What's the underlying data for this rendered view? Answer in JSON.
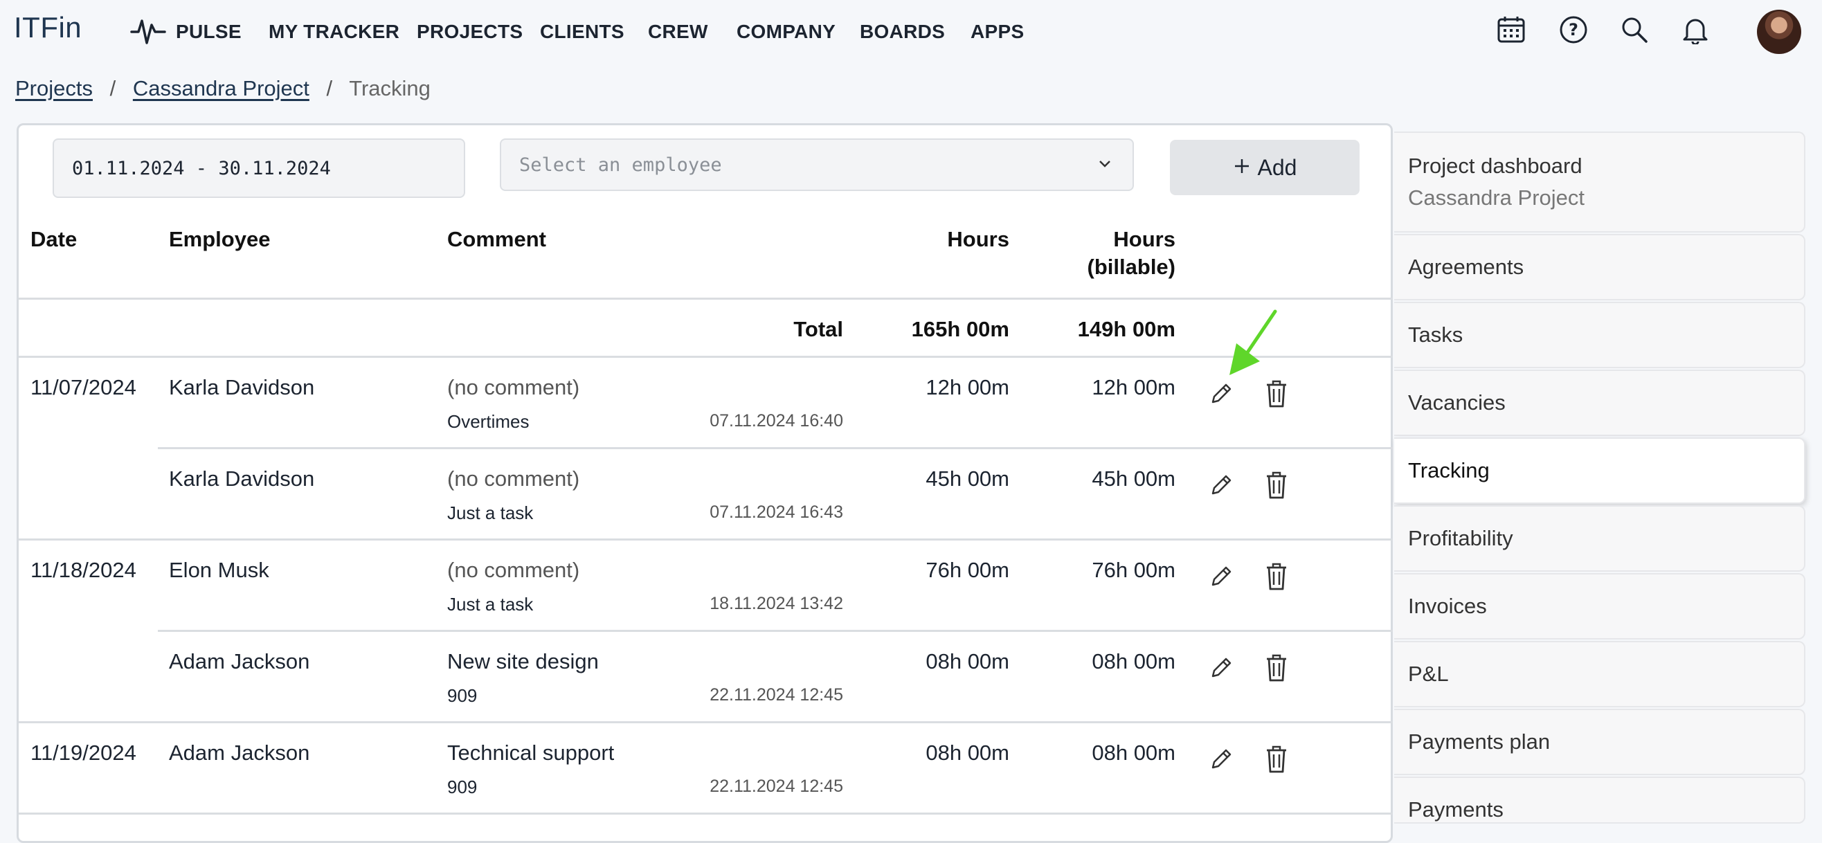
{
  "app": {
    "logo": "ITFin"
  },
  "nav": [
    {
      "label": "PULSE"
    },
    {
      "label": "MY TRACKER"
    },
    {
      "label": "PROJECTS"
    },
    {
      "label": "CLIENTS"
    },
    {
      "label": "CREW"
    },
    {
      "label": "COMPANY"
    },
    {
      "label": "BOARDS"
    },
    {
      "label": "APPS"
    }
  ],
  "header_icons": [
    "calendar-icon",
    "help-icon",
    "search-icon",
    "bell-icon"
  ],
  "breadcrumb": {
    "projects": "Projects",
    "sep": "/",
    "project": "Cassandra Project",
    "current": "Tracking"
  },
  "filters": {
    "date_range": "01.11.2024 - 30.11.2024",
    "employee_placeholder": "Select an employee",
    "add_label": "Add"
  },
  "table": {
    "headers": {
      "date": "Date",
      "employee": "Employee",
      "comment": "Comment",
      "hours": "Hours",
      "billable_line1": "Hours",
      "billable_line2": "(billable)"
    },
    "total": {
      "label": "Total",
      "hours": "165h 00m",
      "billable": "149h 00m"
    },
    "rows": [
      {
        "date": "11/07/2024",
        "employee": "Karla Davidson",
        "comment": "(no comment)",
        "task": "Overtimes",
        "timestamp": "07.11.2024 16:40",
        "hours": "12h 00m",
        "billable": "12h 00m"
      },
      {
        "date": "",
        "employee": "Karla Davidson",
        "comment": "(no comment)",
        "task": "Just a task",
        "timestamp": "07.11.2024 16:43",
        "hours": "45h 00m",
        "billable": "45h 00m"
      },
      {
        "date": "11/18/2024",
        "employee": "Elon Musk",
        "comment": "(no comment)",
        "task": "Just a task",
        "timestamp": "18.11.2024 13:42",
        "hours": "76h 00m",
        "billable": "76h 00m"
      },
      {
        "date": "",
        "employee": "Adam Jackson",
        "comment": "New site design",
        "task": "909",
        "timestamp": "22.11.2024 12:45",
        "hours": "08h 00m",
        "billable": "08h 00m"
      },
      {
        "date": "11/19/2024",
        "employee": "Adam Jackson",
        "comment": "Technical support",
        "task": "909",
        "timestamp": "22.11.2024 12:45",
        "hours": "08h 00m",
        "billable": "08h 00m"
      }
    ]
  },
  "sidebar": {
    "dashboard_title": "Project dashboard",
    "dashboard_subtitle": "Cassandra Project",
    "items": [
      {
        "label": "Agreements"
      },
      {
        "label": "Tasks"
      },
      {
        "label": "Vacancies"
      },
      {
        "label": "Tracking",
        "active": true
      },
      {
        "label": "Profitability"
      },
      {
        "label": "Invoices"
      },
      {
        "label": "P&L"
      },
      {
        "label": "Payments plan"
      },
      {
        "label": "Payments"
      }
    ]
  },
  "colors": {
    "annotation_arrow": "#5fd62a",
    "brand": "#1f3650"
  }
}
